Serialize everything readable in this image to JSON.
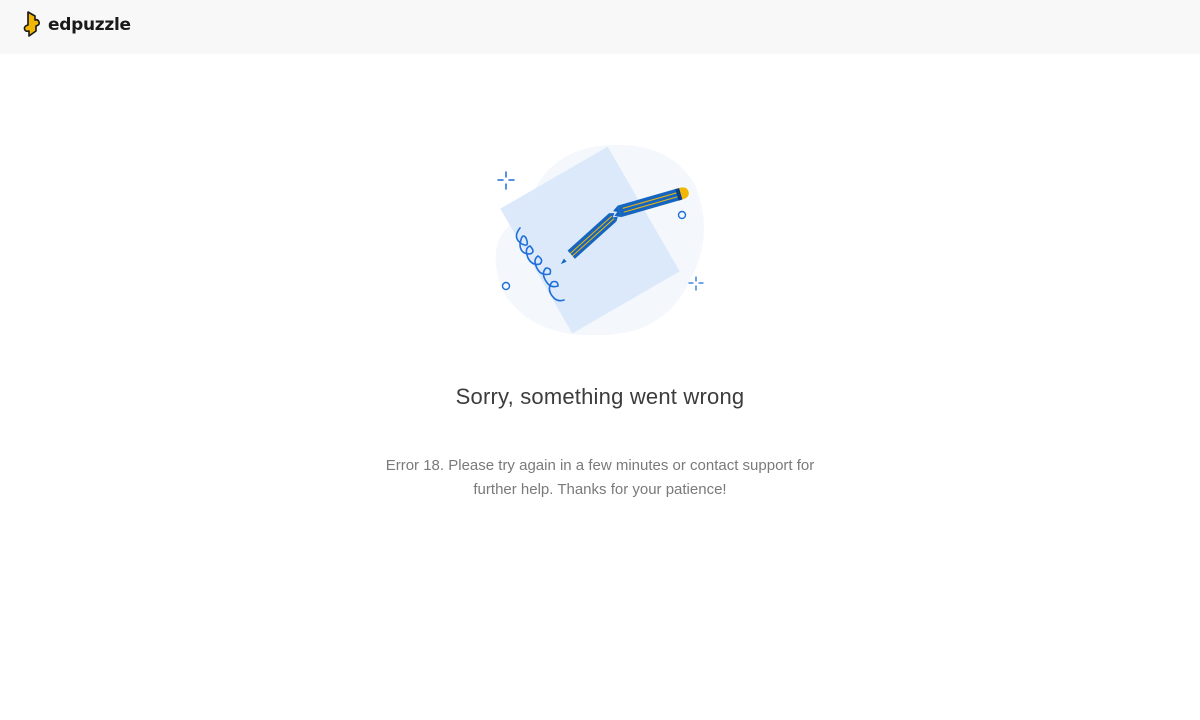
{
  "header": {
    "logo_text": "edpuzzle",
    "logo_icon": "edpuzzle-logo-icon"
  },
  "illustration": {
    "icon": "broken-pencil-illustration",
    "colors": {
      "blob": "#f4f7fb",
      "paper": "#dce9fb",
      "pencil": "#1565c0",
      "pencil_stripe": "#f2b705",
      "eraser": "#f2b705",
      "accent": "#1e6fd9"
    }
  },
  "error": {
    "title": "Sorry, something went wrong",
    "message_line1": "Error 18. Please try again in a few minutes or contact support for",
    "message_line2": "further help. Thanks for your patience!"
  },
  "colors": {
    "header_bg": "#f8f8f8",
    "logo_yellow": "#f2b705",
    "title_text": "#3c3c3c",
    "body_text": "#7a7a7a"
  }
}
